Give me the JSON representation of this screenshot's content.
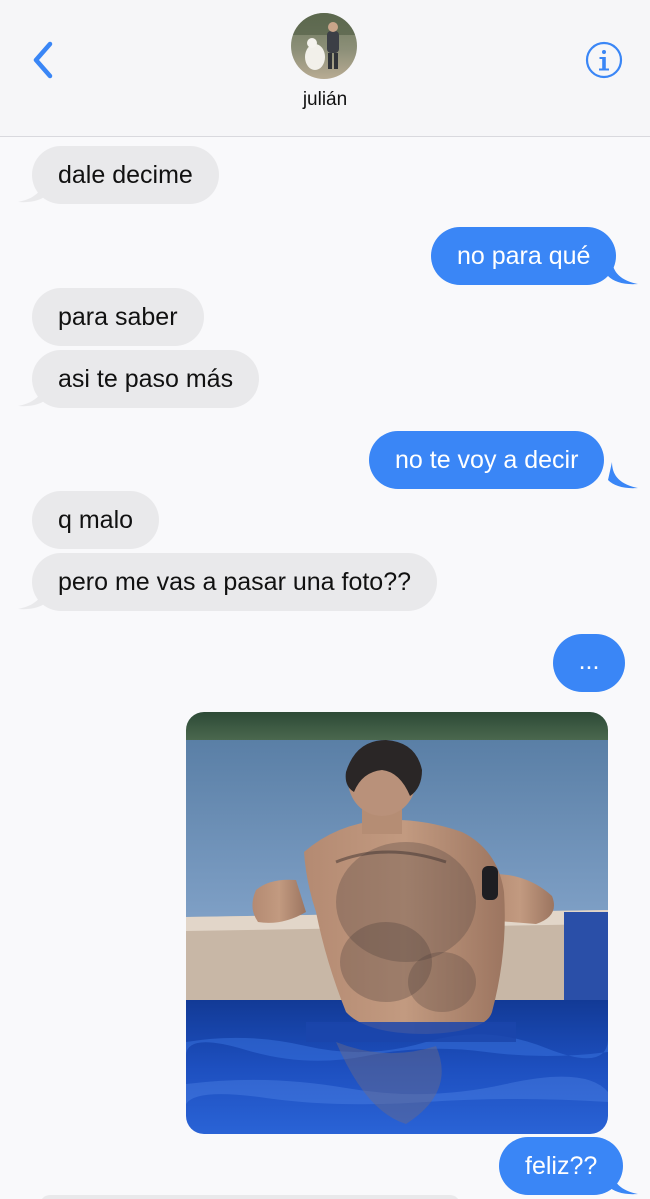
{
  "header": {
    "contact_name": "julián",
    "back_icon": "chevron-left-icon",
    "info_icon": "info-icon"
  },
  "colors": {
    "accent": "#3a86f6",
    "incoming_bubble": "#e9e9eb",
    "background": "#f9f9fb"
  },
  "messages": [
    {
      "sender": "contact",
      "text": "dale decime"
    },
    {
      "sender": "me",
      "text": "no para qué"
    },
    {
      "sender": "contact",
      "text": "para saber"
    },
    {
      "sender": "contact",
      "text": "asi te paso más"
    },
    {
      "sender": "me",
      "text": "no te voy a decir"
    },
    {
      "sender": "contact",
      "text": "q malo"
    },
    {
      "sender": "contact",
      "text": "pero me vas a pasar una foto??"
    },
    {
      "sender": "me",
      "text": "..."
    },
    {
      "sender": "me",
      "type": "image",
      "text": ""
    },
    {
      "sender": "me",
      "text": "feliz??"
    }
  ]
}
